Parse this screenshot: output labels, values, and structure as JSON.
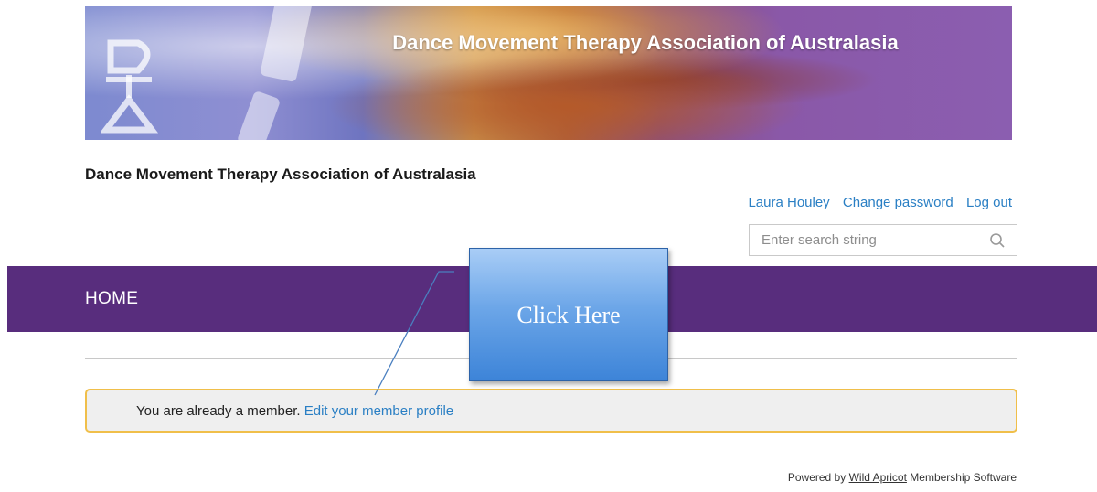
{
  "banner": {
    "title": "Dance Movement Therapy Association of Australasia"
  },
  "site": {
    "title": "Dance Movement Therapy Association of Australasia"
  },
  "user_links": {
    "user_name": "Laura Houley",
    "change_password": "Change password",
    "log_out": "Log out"
  },
  "search": {
    "placeholder": "Enter search string",
    "icon": "search-icon"
  },
  "nav": {
    "home": "HOME"
  },
  "notice": {
    "text": "You are already a member.",
    "link": "Edit your member profile",
    "border_color": "#f0bf4a"
  },
  "footer": {
    "powered_by": "Powered by",
    "link": "Wild Apricot",
    "suffix": "Membership Software"
  },
  "callout": {
    "label": "Click Here"
  },
  "colors": {
    "nav_bg": "#582d7d",
    "link": "#2a7fc4"
  }
}
